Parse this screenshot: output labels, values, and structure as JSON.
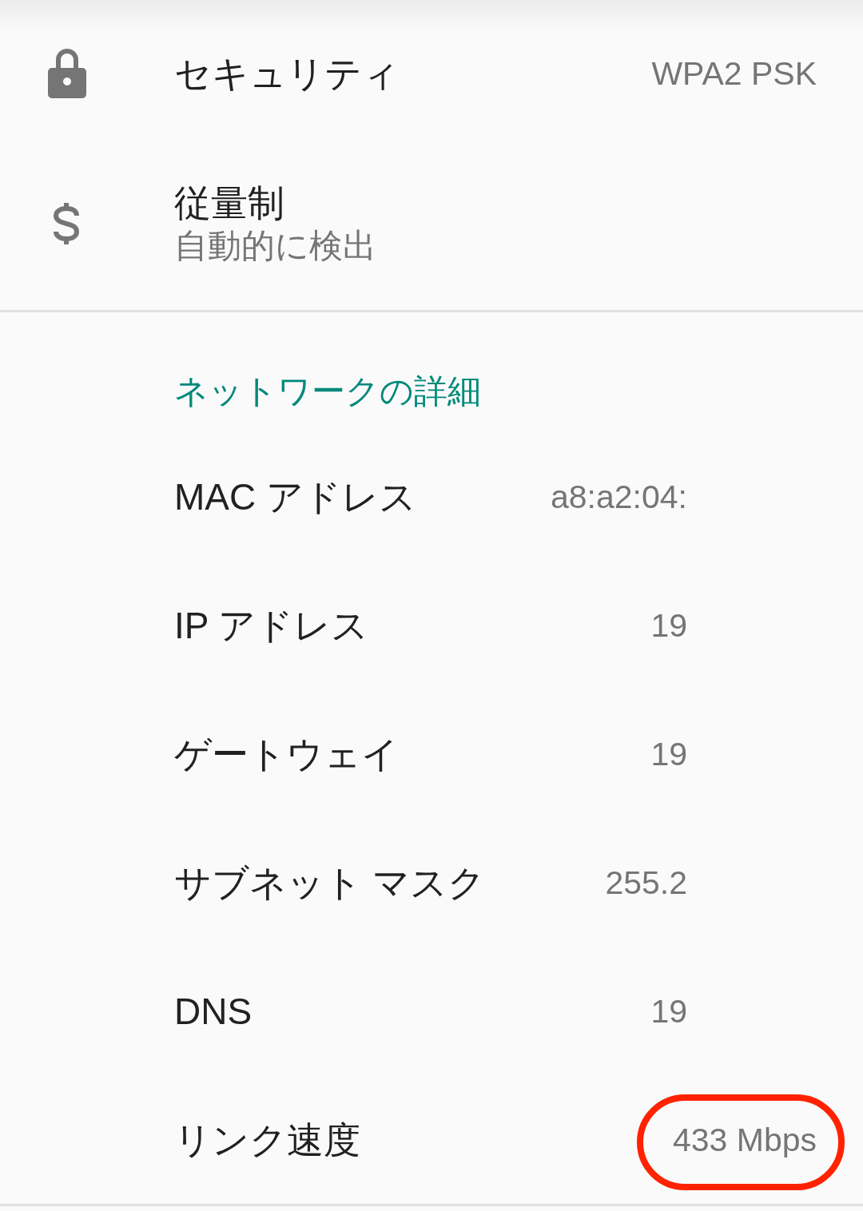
{
  "settings": [
    {
      "kind": "security",
      "title": "セキュリティ",
      "value": "WPA2 PSK"
    },
    {
      "kind": "metered",
      "title": "従量制",
      "subtitle": "自動的に検出"
    }
  ],
  "network_details": {
    "header": "ネットワークの詳細",
    "rows": [
      {
        "kind": "clipped",
        "label": "MAC アドレス",
        "value": "a8:a2:04:",
        "highlighted": false
      },
      {
        "kind": "clipped",
        "label": "IP アドレス",
        "value": "19",
        "highlighted": false
      },
      {
        "kind": "clipped",
        "label": "ゲートウェイ",
        "value": "19",
        "highlighted": false
      },
      {
        "kind": "clipped",
        "label": "サブネット マスク",
        "value": "255.2",
        "highlighted": false
      },
      {
        "kind": "clipped",
        "label": "DNS",
        "value": "19",
        "highlighted": false
      },
      {
        "kind": "full",
        "label": "リンク速度",
        "value": "433 Mbps",
        "highlighted": true
      }
    ]
  }
}
